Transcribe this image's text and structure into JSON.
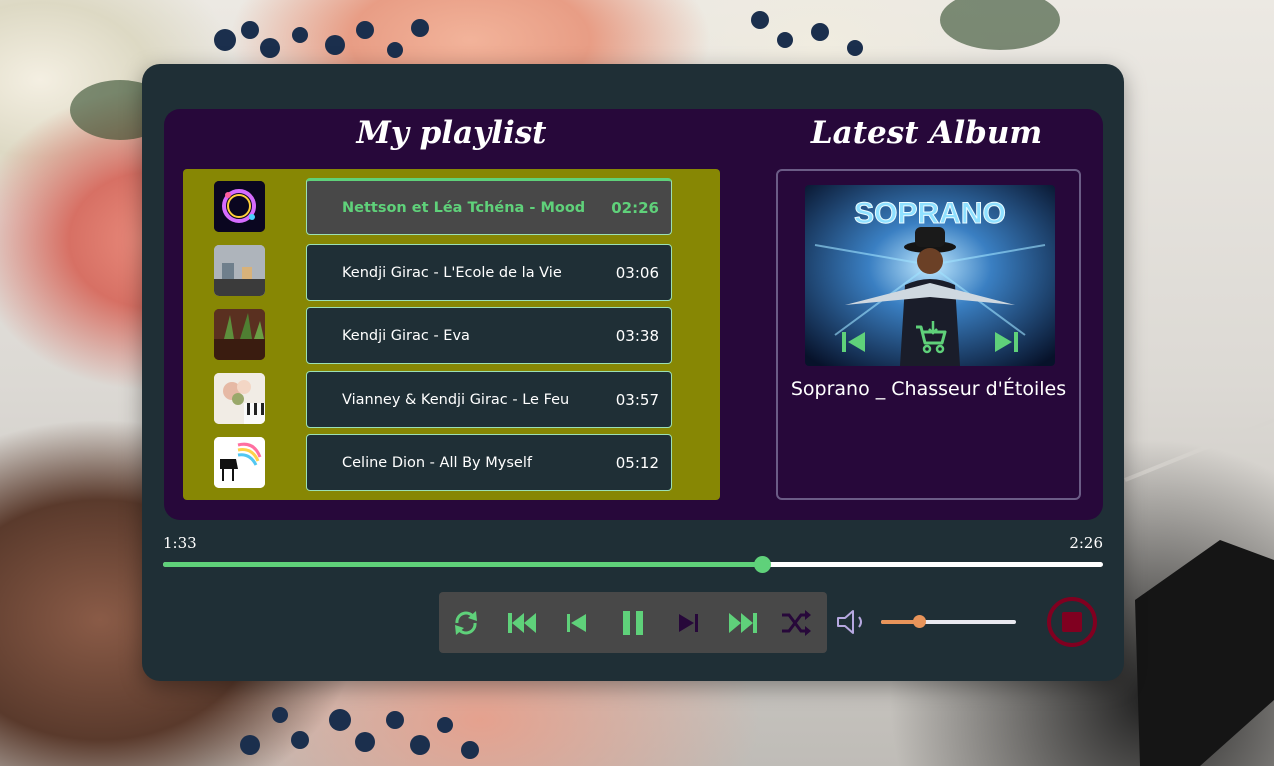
{
  "playlist": {
    "title": "My playlist",
    "tracks": [
      {
        "title": "Nettson et Léa Tchéna - Mood",
        "duration": "02:26",
        "active": true
      },
      {
        "title": "Kendji Girac - L'Ecole de la Vie",
        "duration": "03:06"
      },
      {
        "title": "Kendji Girac - Eva",
        "duration": "03:38"
      },
      {
        "title": "Vianney & Kendji Girac - Le Feu",
        "duration": "03:57"
      },
      {
        "title": "Celine Dion - All By Myself",
        "duration": "05:12"
      }
    ]
  },
  "album": {
    "heading": "Latest Album",
    "art_text": "SOPRANO",
    "name": "Soprano _ Chasseur d'Étoiles"
  },
  "progress": {
    "current": "1:33",
    "duration": "2:26",
    "fraction": 0.637
  },
  "volume": {
    "level": 0.28
  },
  "colors": {
    "accent": "#5fd17a",
    "player_bg": "#1f2f36",
    "panel_bg": "#27083a",
    "list_bg": "#878704",
    "volume": "#e8945a",
    "stop": "#800020",
    "shuffle": "#27083a"
  },
  "icons": {
    "controls": [
      "repeat-icon",
      "fast-rewind-icon",
      "skip-previous-icon",
      "pause-icon",
      "skip-next-icon",
      "fast-forward-icon",
      "shuffle-icon"
    ],
    "album": [
      "skip-previous-icon",
      "shopping-cart-icon",
      "skip-next-icon"
    ],
    "volume": "volume-icon",
    "stop": "stop-icon"
  }
}
